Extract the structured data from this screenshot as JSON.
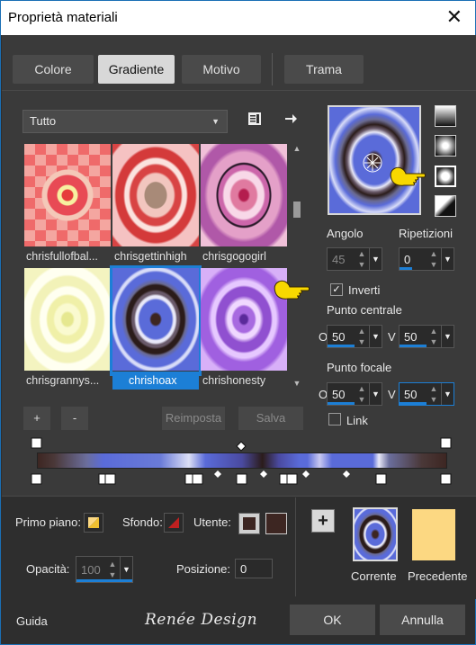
{
  "window": {
    "title": "Proprietà materiali",
    "close_glyph": "✕"
  },
  "tabs": [
    {
      "label": "Colore"
    },
    {
      "label": "Gradiente",
      "active": true
    },
    {
      "label": "Motivo"
    },
    {
      "label": "Trama"
    }
  ],
  "library": {
    "filter_value": "Tutto",
    "options_icon": "book-icon",
    "export_icon": "arrow-right-icon",
    "swatches": [
      {
        "label": "chrisfullofbal..."
      },
      {
        "label": "chrisgettinhigh"
      },
      {
        "label": "chrisgogogirl"
      },
      {
        "label": "chrisgrannys..."
      },
      {
        "label": "chrishoax",
        "selected": true
      },
      {
        "label": "chrishonesty"
      }
    ],
    "add_label": "+",
    "remove_label": "-",
    "reset_label": "Reimposta",
    "save_label": "Salva"
  },
  "settings": {
    "angle_label": "Angolo",
    "angle_value": "45",
    "repeats_label": "Ripetizioni",
    "repeats_value": "0",
    "invert_label": "Inverti",
    "invert_checked": true,
    "center_label": "Punto centrale",
    "center_o_label": "O",
    "center_o_value": "50",
    "center_v_label": "V",
    "center_v_value": "50",
    "focal_label": "Punto focale",
    "focal_o_label": "O",
    "focal_o_value": "50",
    "focal_v_label": "V",
    "focal_v_value": "50",
    "link_label": "Link",
    "link_checked": false,
    "gradient_types": [
      "linear-gradient-icon",
      "rectangular-gradient-icon",
      "radial-gradient-icon",
      "sunburst-gradient-icon"
    ],
    "selected_type": 2
  },
  "bottom": {
    "foreground_label": "Primo piano:",
    "background_label": "Sfondo:",
    "user_label": "Utente:",
    "opacity_label": "Opacità:",
    "opacity_value": "100",
    "position_label": "Posizione:",
    "position_value": "0",
    "current_label": "Corrente",
    "previous_label": "Precedente",
    "previous_color": "#fcd882",
    "user_color": "#3d2622"
  },
  "footer": {
    "help_label": "Guida",
    "logo_text": "Renée Design",
    "ok_label": "OK",
    "cancel_label": "Annulla"
  }
}
